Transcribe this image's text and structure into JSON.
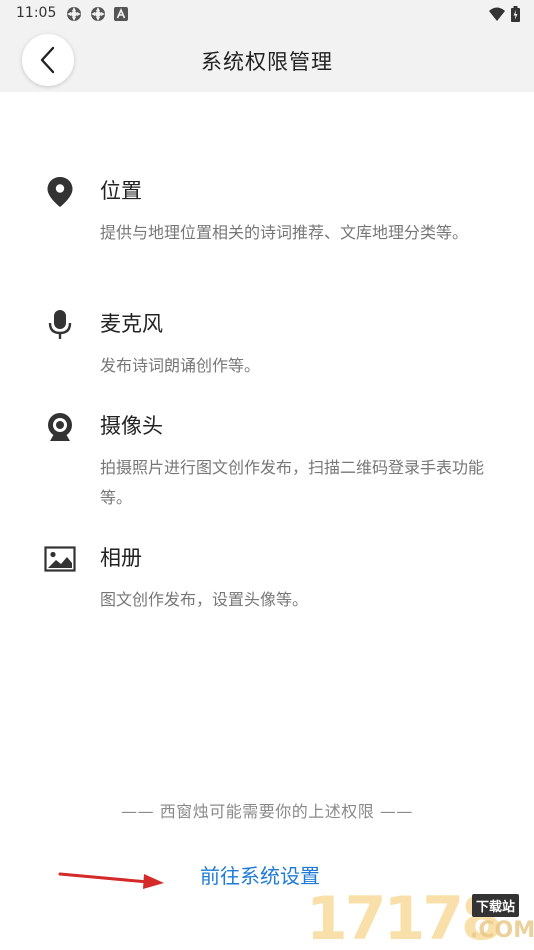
{
  "status_bar": {
    "time": "11:05",
    "left_icons": [
      "app-notification-icon",
      "app-notification-icon",
      "a-badge-icon"
    ],
    "right_icons": [
      "wifi-icon",
      "battery-icon"
    ]
  },
  "header": {
    "title": "系统权限管理",
    "back_icon": "chevron-left-icon"
  },
  "permissions": [
    {
      "icon": "location-pin-icon",
      "title": "位置",
      "desc": "提供与地理位置相关的诗词推荐、文库地理分类等。"
    },
    {
      "icon": "microphone-icon",
      "title": "麦克风",
      "desc": "发布诗词朗诵创作等。"
    },
    {
      "icon": "camera-icon",
      "title": "摄像头",
      "desc": "拍摄照片进行图文创作发布，扫描二维码登录手表功能等。"
    },
    {
      "icon": "image-album-icon",
      "title": "相册",
      "desc": "图文创作发布，设置头像等。"
    }
  ],
  "footer": {
    "note": "—— 西窗烛可能需要你的上述权限 ——",
    "link": "前往系统设置"
  },
  "watermark": {
    "digits": "17178",
    "badge": "下载站",
    "suffix": ".COM"
  },
  "colors": {
    "header_bg": "#f2f2f2",
    "link": "#1e7bd6",
    "desc_text": "#777777",
    "arrow": "#d42a2a"
  }
}
